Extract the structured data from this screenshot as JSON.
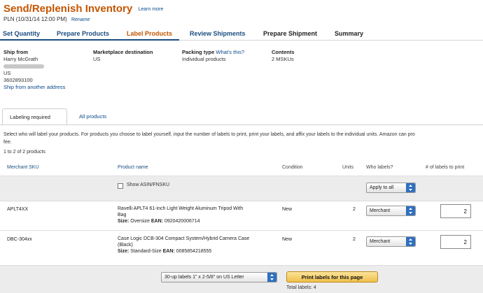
{
  "header": {
    "title": "Send/Replenish Inventory",
    "learn_more": "Learn more",
    "plan_name": "PLN (10/31/14 12:00 PM)",
    "rename": "Rename"
  },
  "workflow": {
    "steps": [
      {
        "label": "Set Quantity",
        "state": "done"
      },
      {
        "label": "Prepare Products",
        "state": "done"
      },
      {
        "label": "Label Products",
        "state": "active"
      },
      {
        "label": "Review Shipments",
        "state": "future-link"
      },
      {
        "label": "Prepare Shipment",
        "state": "future"
      },
      {
        "label": "Summary",
        "state": "future"
      }
    ]
  },
  "shipment_info": {
    "ship_from_label": "Ship from",
    "ship_from_name": "Harry McGrath",
    "ship_from_country": "US",
    "ship_from_phone": "3602893100",
    "ship_from_link": "Ship from another address",
    "marketplace_label": "Marketplace destination",
    "marketplace_value": "US",
    "packing_label": "Packing type",
    "packing_link": "What's this?",
    "packing_value": "Individual products",
    "contents_label": "Contents",
    "contents_value": "2 MSKUs"
  },
  "tabs": [
    {
      "label": "Labeling required",
      "selected": true
    },
    {
      "label": "All products",
      "selected": false
    }
  ],
  "instructions": "Select who will label your products. For products you choose to label yourself, input the number of labels to print, print your labels, and affix your labels to the individual units. Amazon can pro",
  "instructions_cont": "fee.",
  "product_count": "1 to 2 of 2 products",
  "table": {
    "headers": {
      "sku": "Merchant SKU",
      "name": "Product name",
      "condition": "Condition",
      "units": "Units",
      "who": "Who labels?",
      "labels": "# of labels to print"
    },
    "show_asin_label": "Show ASIN/FNSKU",
    "apply_all_label": "Apply to all",
    "rows": [
      {
        "sku": "APLT4XX",
        "name_line1": "Ravelli APLT4 61-inch Light Weight Aluminum Tripod With",
        "name_line2": "Bag",
        "size_label": "Size:",
        "size_value": "Oversize",
        "ean_label": "EAN:",
        "ean_value": "0920420006714",
        "condition": "New",
        "units": "2",
        "who": "Merchant",
        "labels": "2"
      },
      {
        "sku": "DBC-304xx",
        "name_line1": "Case Logic DCB-304 Compact System/Hybrid Camera Case",
        "name_line2": "(Black)",
        "size_label": "Size:",
        "size_value": "Standard-Size",
        "ean_label": "EAN:",
        "ean_value": "0085854218555",
        "condition": "New",
        "units": "2",
        "who": "Merchant",
        "labels": "2"
      }
    ]
  },
  "footer": {
    "label_format": "30-up labels 1\" x 2-5/8\" on US Letter",
    "print_button": "Print labels for this page",
    "total_labels": "Total labels: 4"
  },
  "colors": {
    "title": "#c45500",
    "link": "#1a4d80",
    "select_arrow": "#2f6fc0",
    "print_button": "#f0c04c"
  }
}
